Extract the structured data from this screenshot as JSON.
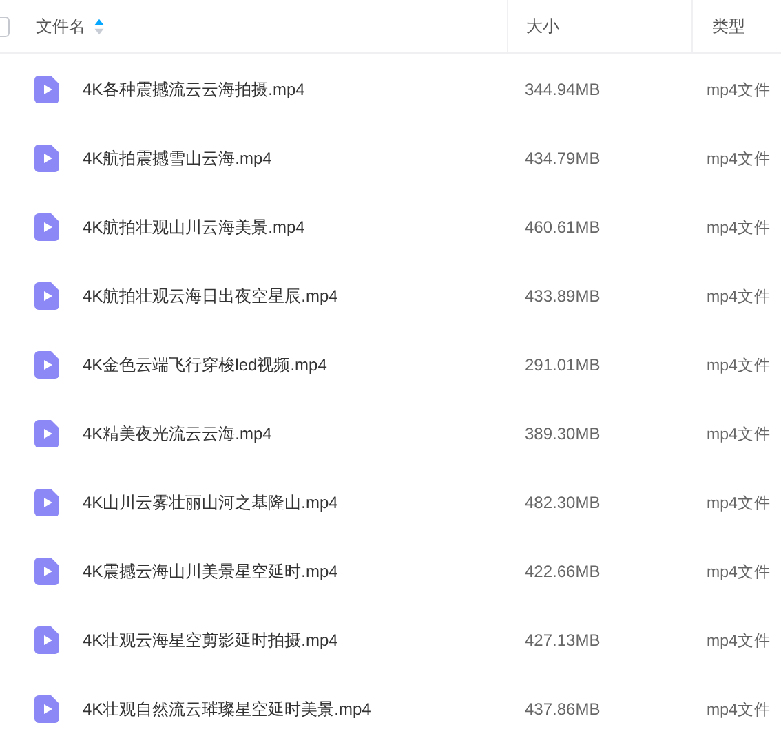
{
  "header": {
    "select_all": {
      "checked": false
    },
    "columns": [
      {
        "label": "文件名",
        "sorted": true
      },
      {
        "label": "大小",
        "sorted": false
      },
      {
        "label": "类型",
        "sorted": false
      }
    ]
  },
  "files": [
    {
      "name": "4K各种震撼流云云海拍摄.mp4",
      "size": "344.94MB",
      "type": "mp4文件"
    },
    {
      "name": "4K航拍震撼雪山云海.mp4",
      "size": "434.79MB",
      "type": "mp4文件"
    },
    {
      "name": "4K航拍壮观山川云海美景.mp4",
      "size": "460.61MB",
      "type": "mp4文件"
    },
    {
      "name": "4K航拍壮观云海日出夜空星辰.mp4",
      "size": "433.89MB",
      "type": "mp4文件"
    },
    {
      "name": "4K金色云端飞行穿梭led视频.mp4",
      "size": "291.01MB",
      "type": "mp4文件"
    },
    {
      "name": "4K精美夜光流云云海.mp4",
      "size": "389.30MB",
      "type": "mp4文件"
    },
    {
      "name": "4K山川云雾壮丽山河之基隆山.mp4",
      "size": "482.30MB",
      "type": "mp4文件"
    },
    {
      "name": "4K震撼云海山川美景星空延时.mp4",
      "size": "422.66MB",
      "type": "mp4文件"
    },
    {
      "name": "4K壮观云海星空剪影延时拍摄.mp4",
      "size": "427.13MB",
      "type": "mp4文件"
    },
    {
      "name": "4K壮观自然流云璀璨星空延时美景.mp4",
      "size": "437.86MB",
      "type": "mp4文件"
    }
  ]
}
